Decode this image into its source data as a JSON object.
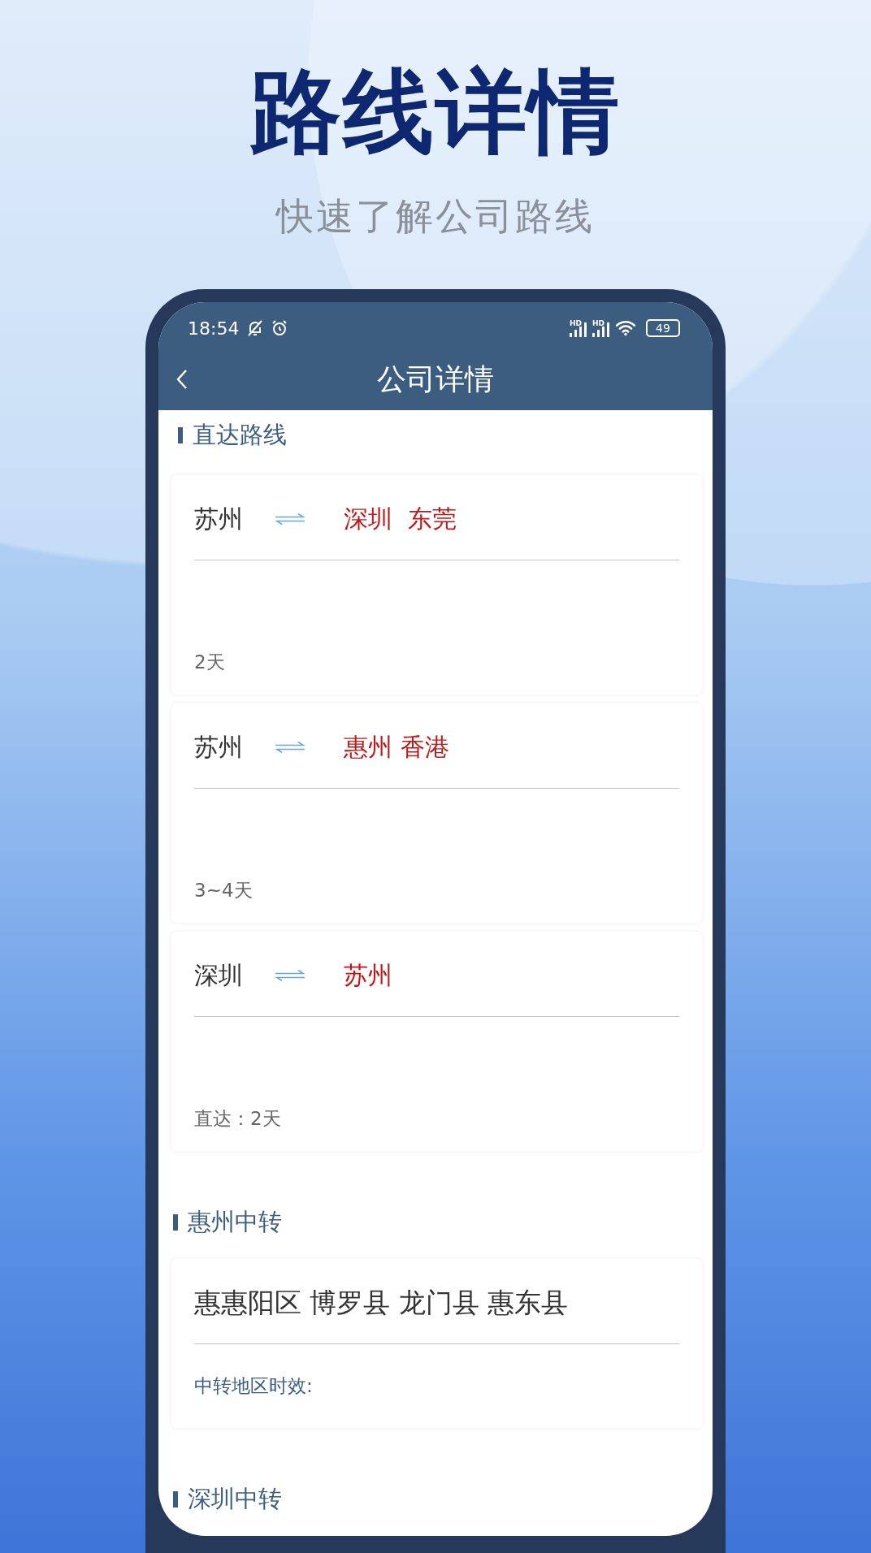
{
  "hero": {
    "title": "路线详情",
    "subtitle": "快速了解公司路线"
  },
  "status_bar": {
    "time": "18:54",
    "signals": [
      {
        "label": "HD"
      },
      {
        "label": "HD"
      }
    ],
    "battery": "49"
  },
  "nav": {
    "title": "公司详情"
  },
  "sections": [
    {
      "title": "直达路线",
      "cards": [
        {
          "kind": "route",
          "origin": "苏州",
          "destination": "深圳  东莞",
          "footer": "2天"
        },
        {
          "kind": "route",
          "origin": "苏州",
          "destination": "惠州 香港",
          "footer": "3~4天"
        },
        {
          "kind": "route",
          "origin": "深圳",
          "destination": "苏州",
          "footer": "直达：2天"
        }
      ]
    },
    {
      "title": "惠州中转",
      "cards": [
        {
          "kind": "transfer",
          "areas": "惠惠阳区 博罗县 龙门县 惠东县",
          "footer": "中转地区时效:"
        }
      ]
    },
    {
      "title": "深圳中转"
    }
  ]
}
